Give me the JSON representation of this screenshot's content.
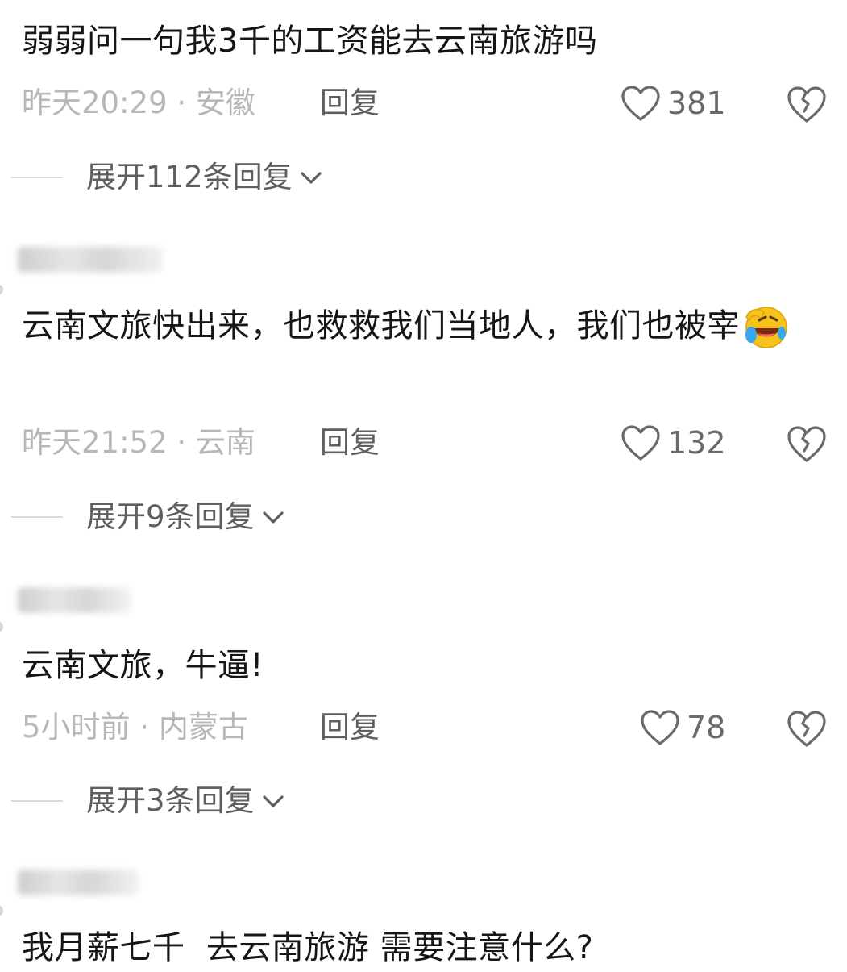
{
  "comments": [
    {
      "text": "弱弱问一句我3千的工资能去云南旅游吗",
      "meta": "昨天20:29 · 安徽",
      "reply_label": "回复",
      "likes": "381",
      "expand_label": "展开112条回复"
    },
    {
      "text": "云南文旅快出来，也救救我们当地人，我们也被宰",
      "emoji": "laughing-crying-emoji",
      "meta": "昨天21:52 · 云南",
      "reply_label": "回复",
      "likes": "132",
      "expand_label": "展开9条回复"
    },
    {
      "text": "云南文旅，牛逼!",
      "meta": "5小时前 · 内蒙古",
      "reply_label": "回复",
      "likes": "78",
      "expand_label": "展开3条回复"
    },
    {
      "text": "我月薪七千  去云南旅游 需要注意什么?"
    }
  ],
  "icons": {
    "like": "heart-outline-icon",
    "dislike": "broken-heart-icon",
    "expand": "chevron-down-icon"
  },
  "colors": {
    "meta_gray": "#b7b7b7",
    "action_gray": "#5f5f5f",
    "text": "#161616"
  }
}
